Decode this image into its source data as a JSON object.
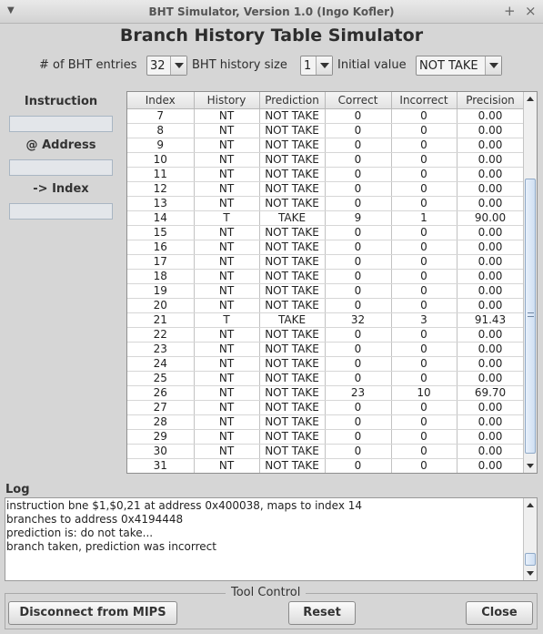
{
  "window": {
    "title": "BHT Simulator, Version 1.0 (Ingo Kofler)"
  },
  "heading": "Branch History Table Simulator",
  "config": {
    "entries_label": "# of BHT entries",
    "entries_value": "32",
    "history_label": "BHT history size",
    "history_value": "1",
    "initial_label": "Initial value",
    "initial_value": "NOT TAKE"
  },
  "side": {
    "instruction_label": "Instruction",
    "address_label": "@ Address",
    "index_label": "-> Index"
  },
  "table": {
    "columns": [
      "Index",
      "History",
      "Prediction",
      "Correct",
      "Incorrect",
      "Precision"
    ],
    "rows": [
      [
        "7",
        "NT",
        "NOT TAKE",
        "0",
        "0",
        "0.00"
      ],
      [
        "8",
        "NT",
        "NOT TAKE",
        "0",
        "0",
        "0.00"
      ],
      [
        "9",
        "NT",
        "NOT TAKE",
        "0",
        "0",
        "0.00"
      ],
      [
        "10",
        "NT",
        "NOT TAKE",
        "0",
        "0",
        "0.00"
      ],
      [
        "11",
        "NT",
        "NOT TAKE",
        "0",
        "0",
        "0.00"
      ],
      [
        "12",
        "NT",
        "NOT TAKE",
        "0",
        "0",
        "0.00"
      ],
      [
        "13",
        "NT",
        "NOT TAKE",
        "0",
        "0",
        "0.00"
      ],
      [
        "14",
        "T",
        "TAKE",
        "9",
        "1",
        "90.00"
      ],
      [
        "15",
        "NT",
        "NOT TAKE",
        "0",
        "0",
        "0.00"
      ],
      [
        "16",
        "NT",
        "NOT TAKE",
        "0",
        "0",
        "0.00"
      ],
      [
        "17",
        "NT",
        "NOT TAKE",
        "0",
        "0",
        "0.00"
      ],
      [
        "18",
        "NT",
        "NOT TAKE",
        "0",
        "0",
        "0.00"
      ],
      [
        "19",
        "NT",
        "NOT TAKE",
        "0",
        "0",
        "0.00"
      ],
      [
        "20",
        "NT",
        "NOT TAKE",
        "0",
        "0",
        "0.00"
      ],
      [
        "21",
        "T",
        "TAKE",
        "32",
        "3",
        "91.43"
      ],
      [
        "22",
        "NT",
        "NOT TAKE",
        "0",
        "0",
        "0.00"
      ],
      [
        "23",
        "NT",
        "NOT TAKE",
        "0",
        "0",
        "0.00"
      ],
      [
        "24",
        "NT",
        "NOT TAKE",
        "0",
        "0",
        "0.00"
      ],
      [
        "25",
        "NT",
        "NOT TAKE",
        "0",
        "0",
        "0.00"
      ],
      [
        "26",
        "NT",
        "NOT TAKE",
        "23",
        "10",
        "69.70"
      ],
      [
        "27",
        "NT",
        "NOT TAKE",
        "0",
        "0",
        "0.00"
      ],
      [
        "28",
        "NT",
        "NOT TAKE",
        "0",
        "0",
        "0.00"
      ],
      [
        "29",
        "NT",
        "NOT TAKE",
        "0",
        "0",
        "0.00"
      ],
      [
        "30",
        "NT",
        "NOT TAKE",
        "0",
        "0",
        "0.00"
      ],
      [
        "31",
        "NT",
        "NOT TAKE",
        "0",
        "0",
        "0.00"
      ]
    ]
  },
  "log": {
    "label": "Log",
    "lines": [
      "instruction bne $1,$0,21 at address 0x400038, maps to index 14",
      "branches to address 0x4194448",
      "prediction is: do not take...",
      "branch taken, prediction was incorrect"
    ]
  },
  "tool_control": {
    "label": "Tool Control",
    "disconnect_label": "Disconnect from MIPS",
    "reset_label": "Reset",
    "close_label": "Close"
  }
}
